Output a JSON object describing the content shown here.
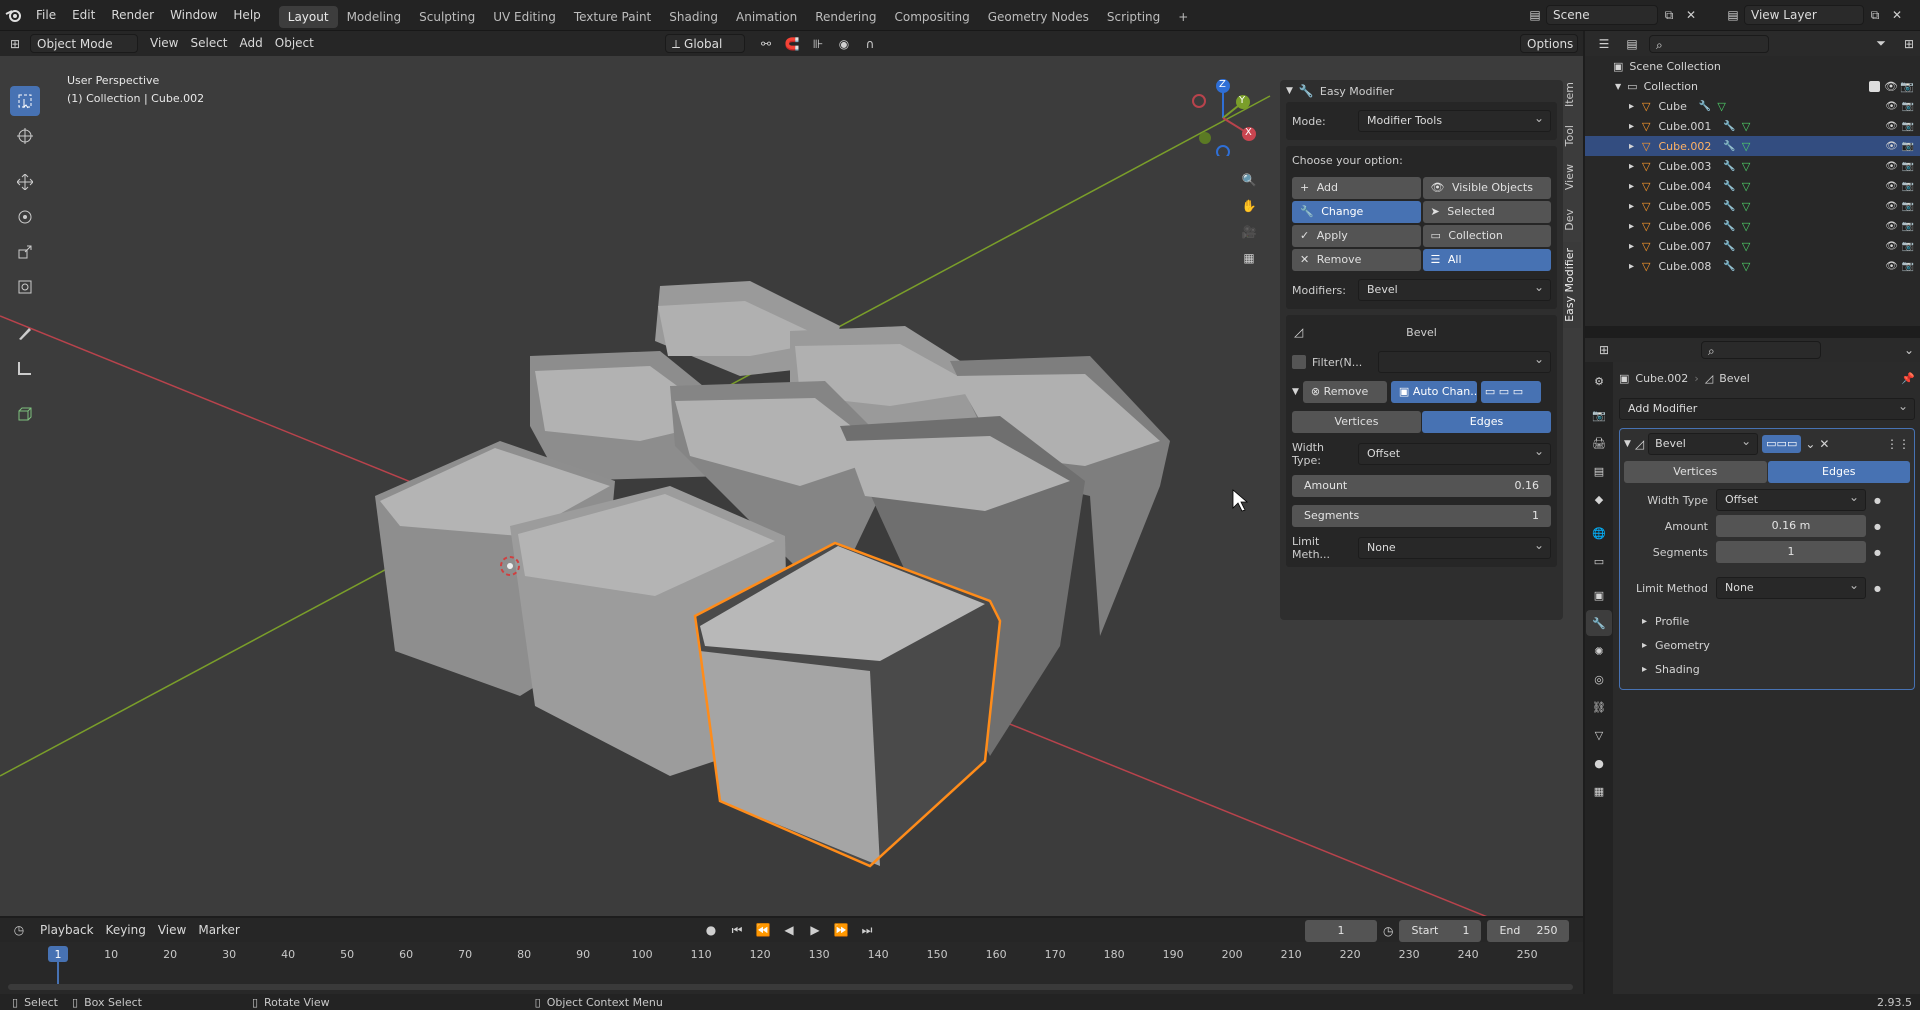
{
  "menus": [
    "File",
    "Edit",
    "Render",
    "Window",
    "Help"
  ],
  "workspaces": [
    "Layout",
    "Modeling",
    "Sculpting",
    "UV Editing",
    "Texture Paint",
    "Shading",
    "Animation",
    "Rendering",
    "Compositing",
    "Geometry Nodes",
    "Scripting"
  ],
  "active_workspace": "Layout",
  "scene_name": "Scene",
  "view_layer": "View Layer",
  "transform_orientation": "Global",
  "options_label": "Options",
  "viewport_header": {
    "mode": "Object Mode",
    "items": [
      "View",
      "Select",
      "Add",
      "Object"
    ]
  },
  "viewport_overlay": {
    "line1": "User Perspective",
    "line2": "(1) Collection | Cube.002"
  },
  "gizmo": {
    "x": "X",
    "y": "Y",
    "z": "Z"
  },
  "sidebar_tabs": [
    "Item",
    "Tool",
    "View",
    "Dev",
    "Easy Modifier"
  ],
  "easy_modifier": {
    "title": "Easy Modifier",
    "mode_label": "Mode:",
    "mode_value": "Modifier Tools",
    "choose_label": "Choose your option:",
    "actions": [
      "Add",
      "Change",
      "Apply",
      "Remove"
    ],
    "active_action": "Change",
    "targets": [
      "Visible Objects",
      "Selected",
      "Collection",
      "All"
    ],
    "active_target": "All",
    "modifiers_label": "Modifiers:",
    "modifiers_value": "Bevel",
    "bevel_title": "Bevel",
    "filter_label": "Filter(N...",
    "remove_label": "Remove",
    "autochan_label": "Auto Chan...",
    "affect": [
      "Vertices",
      "Edges"
    ],
    "affect_active": "Edges",
    "width_type_label": "Width Type:",
    "width_type_value": "Offset",
    "amount_label": "Amount",
    "amount_value": "0.16",
    "segments_label": "Segments",
    "segments_value": "1",
    "limit_label": "Limit Meth...",
    "limit_value": "None"
  },
  "outliner": {
    "root": "Scene Collection",
    "collection": "Collection",
    "objects": [
      "Cube",
      "Cube.001",
      "Cube.002",
      "Cube.003",
      "Cube.004",
      "Cube.005",
      "Cube.006",
      "Cube.007",
      "Cube.008"
    ],
    "selected": "Cube.002"
  },
  "properties": {
    "breadcrumb_object": "Cube.002",
    "breadcrumb_modifier": "Bevel",
    "add_modifier": "Add Modifier",
    "modifier_name": "Bevel",
    "affect": [
      "Vertices",
      "Edges"
    ],
    "affect_active": "Edges",
    "width_type_label": "Width Type",
    "width_type_value": "Offset",
    "amount_label": "Amount",
    "amount_value": "0.16 m",
    "segments_label": "Segments",
    "segments_value": "1",
    "limit_label": "Limit Method",
    "limit_value": "None",
    "subpanels": [
      "Profile",
      "Geometry",
      "Shading"
    ]
  },
  "timeline": {
    "menus": [
      "Playback",
      "Keying",
      "View",
      "Marker"
    ],
    "current_frame": "1",
    "start_label": "Start",
    "start_value": "1",
    "end_label": "End",
    "end_value": "250",
    "ticks": [
      "1",
      "10",
      "20",
      "30",
      "40",
      "50",
      "60",
      "70",
      "80",
      "90",
      "100",
      "110",
      "120",
      "130",
      "140",
      "150",
      "160",
      "170",
      "180",
      "190",
      "200",
      "210",
      "220",
      "230",
      "240",
      "250"
    ]
  },
  "statusbar": {
    "select": "Select",
    "box_select": "Box Select",
    "rotate": "Rotate View",
    "context": "Object Context Menu",
    "version": "2.93.5"
  },
  "colors": {
    "accent": "#4772b3",
    "selection": "#ff8c1a",
    "x_axis": "#b8434c",
    "y_axis": "#7a9e2a",
    "viewport_bg": "#3c3c3c"
  }
}
